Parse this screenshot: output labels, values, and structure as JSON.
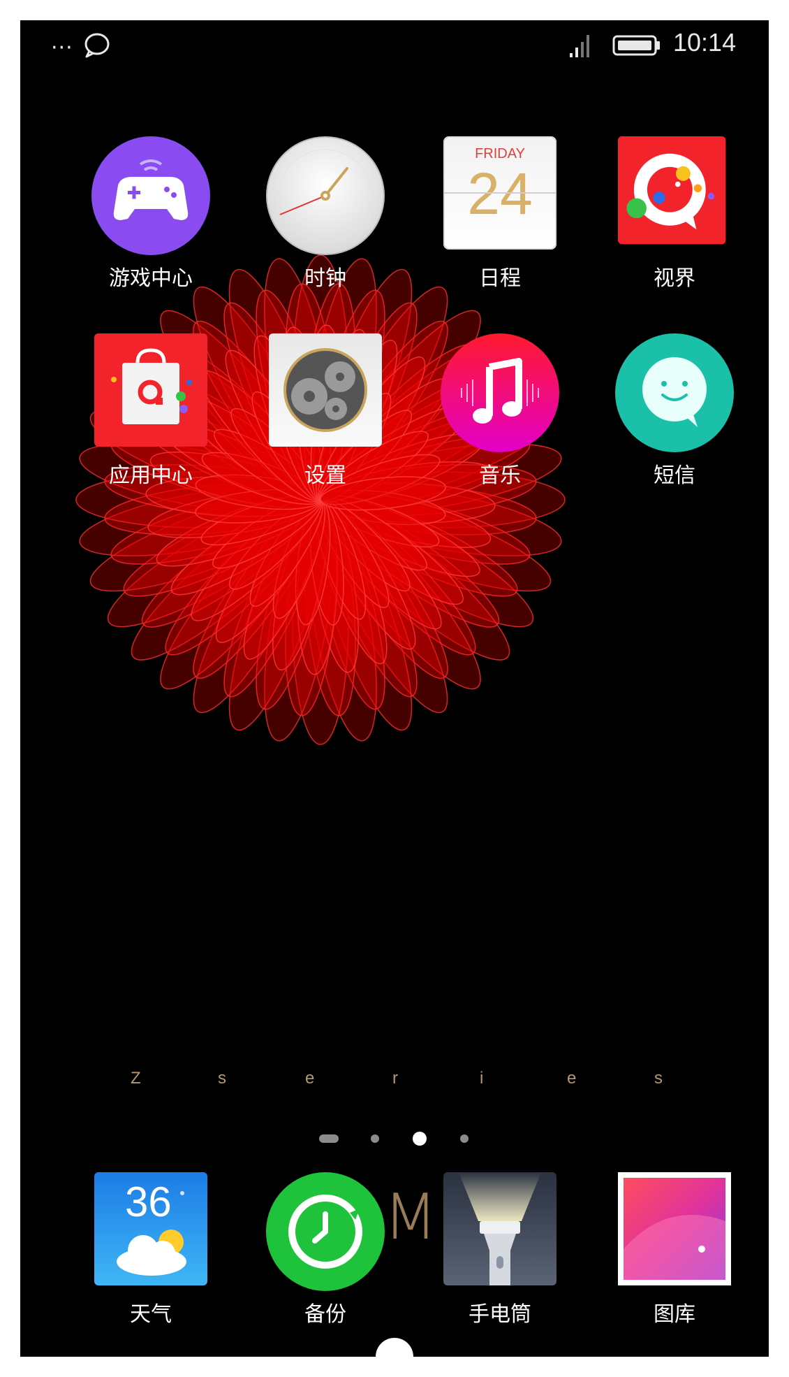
{
  "status_bar": {
    "more_icon": "···",
    "time": "10:14"
  },
  "wallpaper": {
    "colors": {
      "petal": "#e60000",
      "center": "#ff0000"
    }
  },
  "home": {
    "apps": [
      {
        "label": "游戏中心",
        "icon": "gamepad-icon"
      },
      {
        "label": "时钟",
        "icon": "clock-icon"
      },
      {
        "label": "日程",
        "icon": "calendar-icon",
        "day_name": "FRIDAY",
        "day_number": "24"
      },
      {
        "label": "视界",
        "icon": "video-icon"
      },
      {
        "label": "应用中心",
        "icon": "app-store-icon"
      },
      {
        "label": "设置",
        "icon": "settings-gear-icon"
      },
      {
        "label": "音乐",
        "icon": "music-note-icon"
      },
      {
        "label": "短信",
        "icon": "message-smile-icon"
      }
    ],
    "brand_text": [
      "Z",
      "s",
      "e",
      "r",
      "i",
      "e",
      "s"
    ],
    "page_indicator": {
      "pages": 4,
      "current": 3
    }
  },
  "dock": {
    "apps": [
      {
        "label": "天气",
        "icon": "weather-icon",
        "temperature": "36"
      },
      {
        "label": "备份",
        "icon": "backup-clock-icon"
      },
      {
        "label": "手电筒",
        "icon": "flashlight-icon"
      },
      {
        "label": "图库",
        "icon": "gallery-icon"
      }
    ],
    "center_mark": "M"
  }
}
